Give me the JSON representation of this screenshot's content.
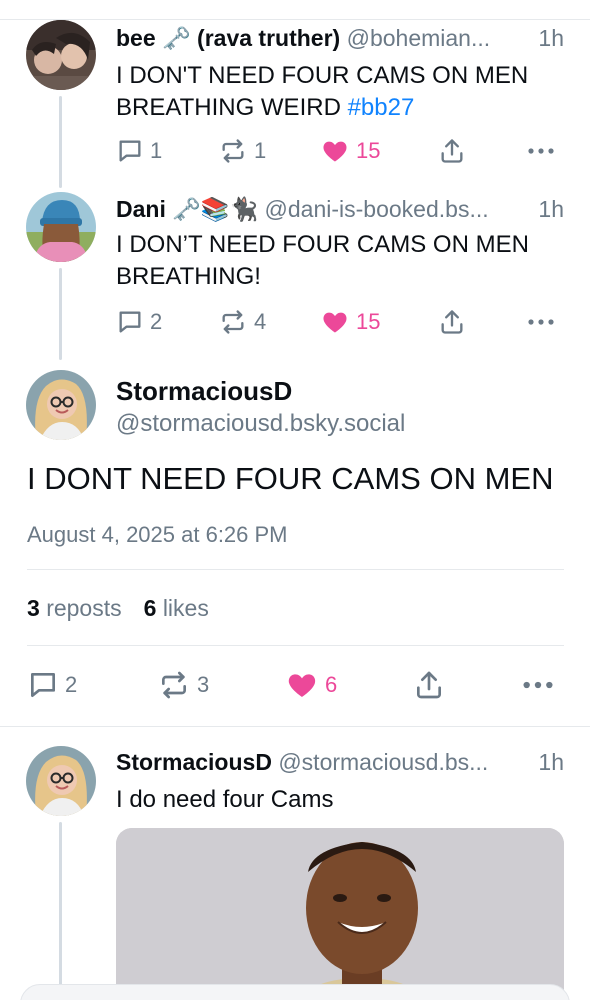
{
  "replies": [
    {
      "name": "bee 🗝️ (rava truther)",
      "handle": "@bohemian...",
      "time": "1h",
      "text": "I DON'T NEED FOUR CAMS ON MEN BREATHING WEIRD ",
      "hashtag": "#bb27",
      "replies": "1",
      "reposts": "1",
      "likes": "15"
    },
    {
      "name": "Dani 🗝️📚🐈‍⬛",
      "handle": "@dani-is-booked.bs...",
      "time": "1h",
      "text": "I DON’T NEED FOUR CAMS ON MEN BREATHING!",
      "replies": "2",
      "reposts": "4",
      "likes": "15"
    }
  ],
  "main_post": {
    "name": "StormaciousD",
    "handle": "@stormaciousd.bsky.social",
    "text": "I DONT NEED FOUR CAMS ON MEN",
    "date": "August 4, 2025 at 6:26 PM",
    "reposts_count": "3",
    "reposts_label": "reposts",
    "likes_count": "6",
    "likes_label": "likes",
    "replies": "2",
    "reposts": "3",
    "likes": "6"
  },
  "reply_post": {
    "name": "StormaciousD",
    "handle": "@stormaciousd.bs...",
    "time": "1h",
    "text": "I do need four Cams"
  },
  "icons": {
    "reply": "reply-icon",
    "repost": "repost-icon",
    "like": "heart-icon",
    "share": "share-icon",
    "more": "more-icon"
  },
  "colors": {
    "accent_link": "#1083fe",
    "liked": "#ec4899",
    "muted_text": "#6b7986",
    "thread_line": "#d4dbe2"
  }
}
